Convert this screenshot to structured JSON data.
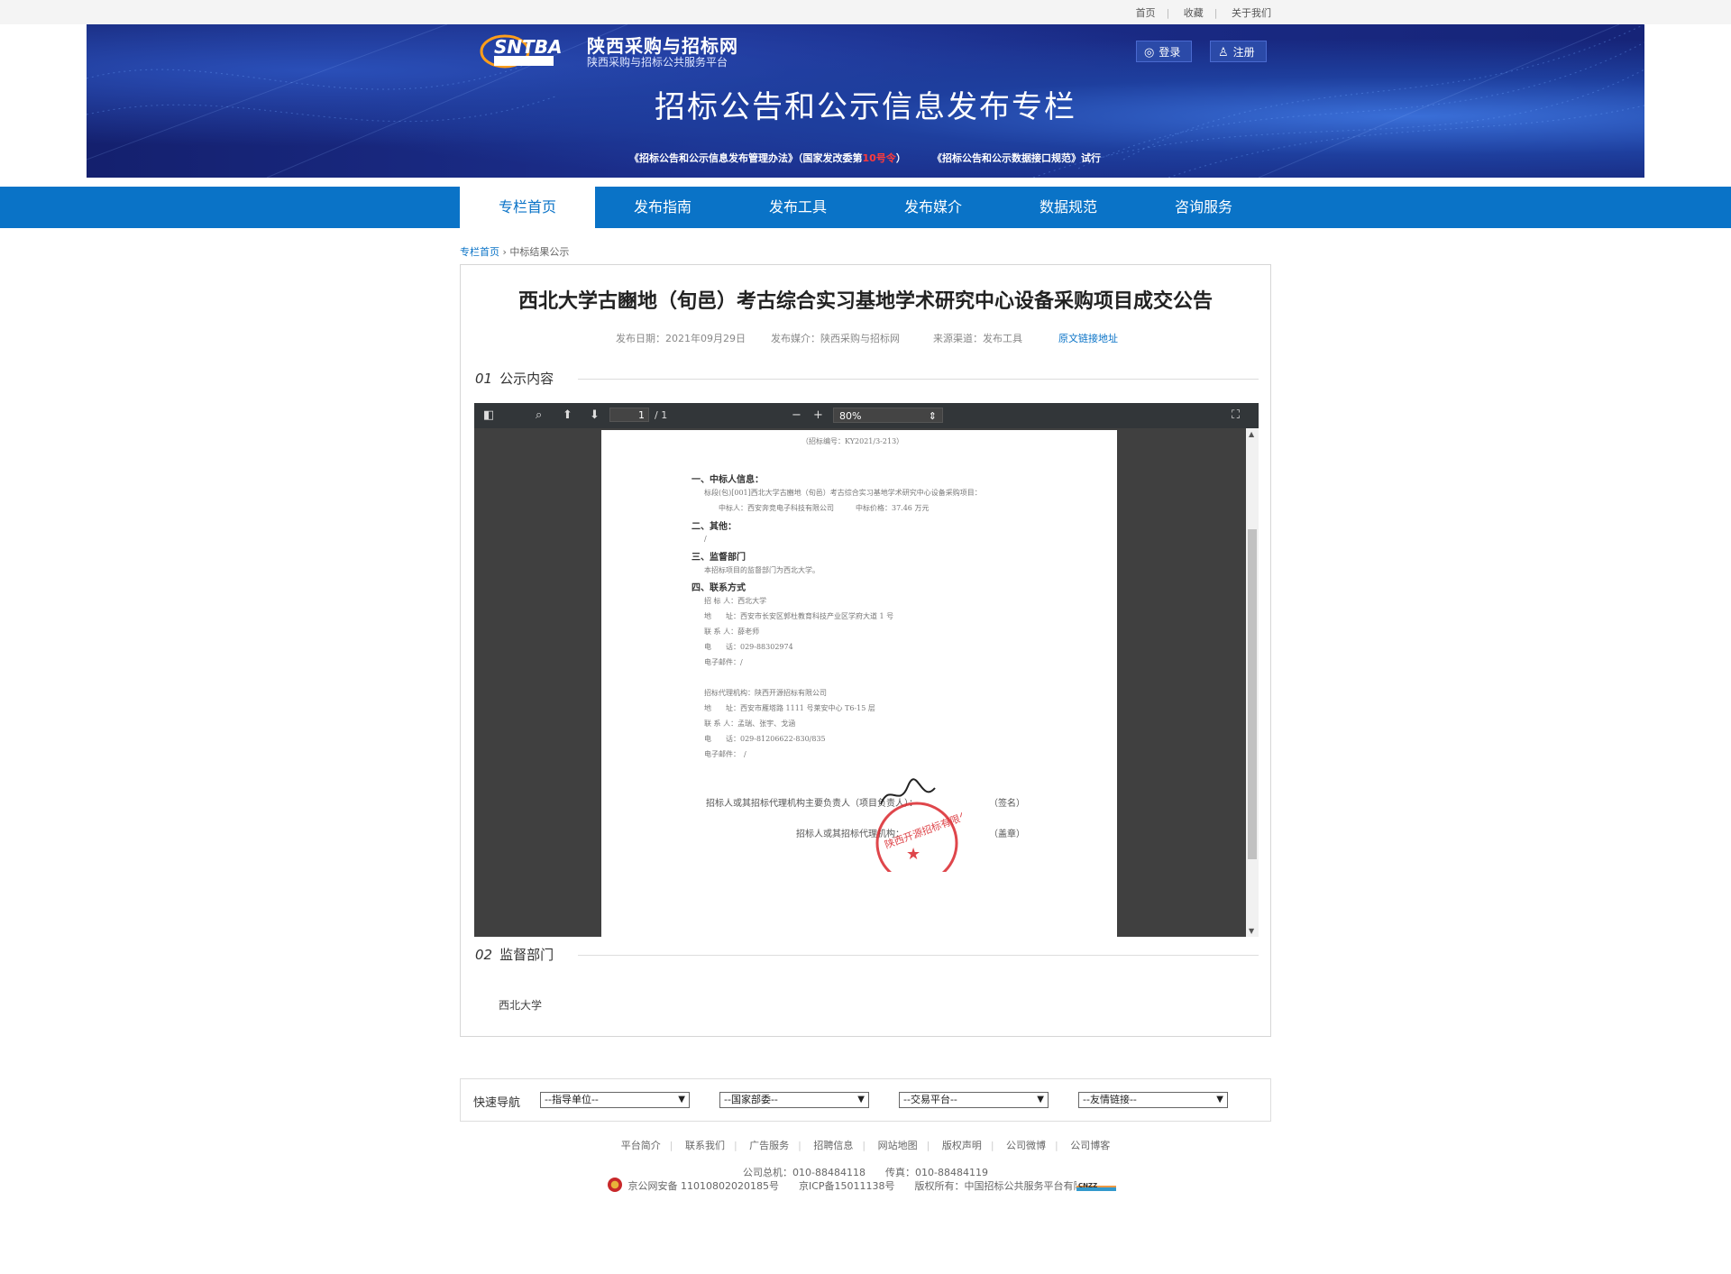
{
  "toplinks": [
    "首页",
    "收藏",
    "关于我们"
  ],
  "site": {
    "name": "陕西采购与招标网",
    "subtitle": "陕西采购与招标公共服务平台",
    "logo_text": "SNTBA"
  },
  "auth": {
    "login": "登录",
    "register": "注册"
  },
  "banner": {
    "title": "招标公告和公示信息发布专栏",
    "notice1_pre": "《招标公告和公示信息发布管理办法》（国家发改委第",
    "notice1_red": "10号令",
    "notice1_post": "）",
    "notice2": "《招标公告和公示数据接口规范》试行"
  },
  "nav": [
    "专栏首页",
    "发布指南",
    "发布工具",
    "发布媒介",
    "数据规范",
    "咨询服务"
  ],
  "breadcrumb": {
    "home": "专栏首页",
    "current": "中标结果公示"
  },
  "article": {
    "title": "西北大学古豳地（旬邑）考古综合实习基地学术研究中心设备采购项目成交公告",
    "date": "发布日期：2021年09月29日",
    "media": "发布媒介：陕西采购与招标网",
    "source": "来源渠道：发布工具",
    "link": "原文链接地址"
  },
  "sections": [
    {
      "num": "01",
      "label": "公示内容"
    },
    {
      "num": "02",
      "label": "监督部门",
      "content": "西北大学"
    }
  ],
  "pdf": {
    "page": "1",
    "total": "/ 1",
    "zoom": "80%",
    "lines": [
      "（招标编号：KY2021/3-213）",
      "一、中标人信息：",
      "标段(包)[001]西北大学古豳地（旬邑）考古综合实习基地学术研究中心设备采购项目：",
      "中标人：西安奔竞电子科技有限公司　　　中标价格：37.46 万元",
      "二、其他：",
      "/",
      "三、监督部门",
      "本招标项目的监督部门为西北大学。",
      "四、联系方式",
      "招 标 人：西北大学",
      "地　　址：西安市长安区郭杜教育科技产业区学府大道 1 号",
      "联 系 人：薛老师",
      "电　　话：029-88302974",
      "电子邮件：/",
      "招标代理机构：陕西开源招标有限公司",
      "地　　址：西安市雁塔路 1111 号莱安中心 T6-15 层",
      "联 系 人：孟瑞、张宇、戈涵",
      "电　　话：029-81206622-830/835",
      "电子邮件：　/",
      "招标人或其招标代理机构主要负责人（项目负责人）：",
      "（签名）",
      "招标人或其招标代理机构：",
      "（盖章）"
    ],
    "stamp_text": "陕西开源招标有限公司",
    "signature": "张宇"
  },
  "footer": {
    "quicknav": "快速导航",
    "selects": [
      "--指导单位--",
      "--国家部委--",
      "--交易平台--",
      "--友情链接--"
    ],
    "links": [
      "平台简介",
      "联系我们",
      "广告服务",
      "招聘信息",
      "网站地图",
      "版权声明",
      "公司微博",
      "公司博客"
    ],
    "phone": "公司总机：010-88484118　　传真：010-88484119",
    "icp": "京公网安备 11010802020185号　　京ICP备15011138号　　版权所有：中国招标公共服务平台有限公司",
    "cnzz": "CNZZ"
  },
  "colors": {
    "nav": "#0a73c7",
    "banner": "#1c2f8e",
    "stamp": "#d9262c"
  }
}
